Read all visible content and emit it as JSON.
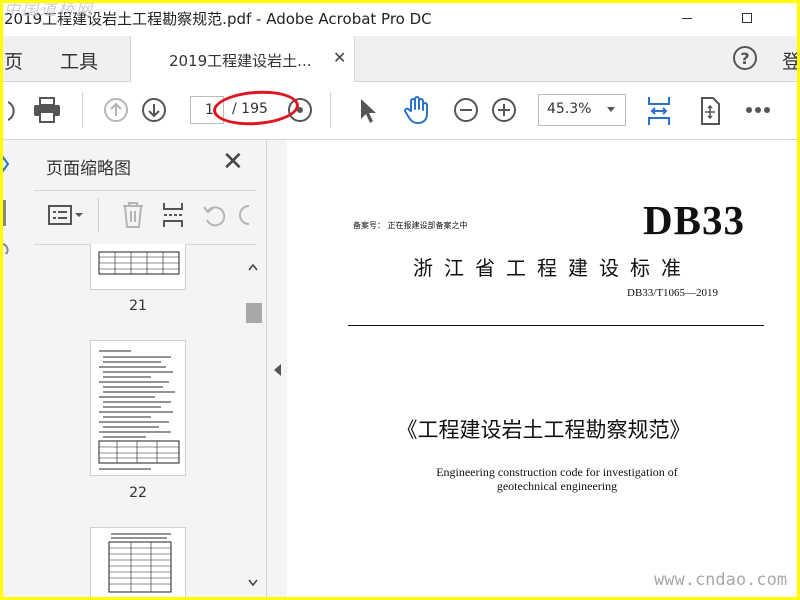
{
  "window": {
    "title": "2019工程建设岩土工程勘察规范.pdf - Adobe Acrobat Pro DC"
  },
  "tabs": {
    "home": "首页",
    "home_visible": "页",
    "tools": "工具",
    "document": "2019工程建设岩土...",
    "help_symbol": "?",
    "signin": "登"
  },
  "toolbar": {
    "current_page": "1",
    "total_pages": "/ 195",
    "zoom": "45.3%",
    "icons": [
      "print-icon",
      "page-up-icon",
      "page-down-icon",
      "select-pointer-icon",
      "hand-tool-icon",
      "zoom-out-icon",
      "zoom-in-icon",
      "fit-page-icon",
      "rotate-view-icon",
      "more-icon"
    ]
  },
  "panel": {
    "title": "页面缩略图",
    "close_symbol": "✕",
    "tools": [
      "thumbnail-options-icon",
      "delete-page-icon",
      "insert-page-icon",
      "undo-icon"
    ],
    "thumbnails": [
      {
        "label": "21"
      },
      {
        "label": "22"
      },
      {
        "label": ""
      }
    ]
  },
  "document": {
    "filing_note": "备案号：  正在报建设部备案之中",
    "db_mark": "DB33",
    "standard_name": "浙江省工程建设标准",
    "standard_code": "DB33/T1065—2019",
    "title_cn": "《工程建设岩土工程勘察规范》",
    "title_en_line1": "Engineering construction code for investigation of",
    "title_en_line2": "geotechnical engineering"
  },
  "watermarks": {
    "top": "中国道桥网",
    "bottom": "www.cndao.com"
  },
  "colors": {
    "frame": "#ffff00",
    "annotation": "#e0141c",
    "hand_tool": "#2a73c9"
  }
}
